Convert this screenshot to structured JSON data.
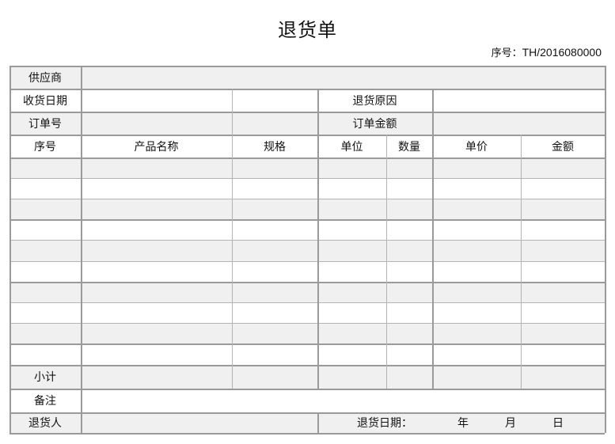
{
  "title": "退货单",
  "serial": {
    "label": "序号：",
    "value": "TH/2016080000"
  },
  "labels": {
    "supplier": "供应商",
    "receive_date": "收货日期",
    "return_reason": "退货原因",
    "order_no": "订单号",
    "order_amount": "订单金额",
    "subtotal": "小计",
    "remarks": "备注",
    "returner": "退货人",
    "return_date": "退货日期：",
    "year": "年",
    "month": "月",
    "day": "日"
  },
  "columns": [
    "序号",
    "产品名称",
    "规格",
    "单位",
    "数量",
    "单价",
    "金额"
  ],
  "item_rows": 10
}
